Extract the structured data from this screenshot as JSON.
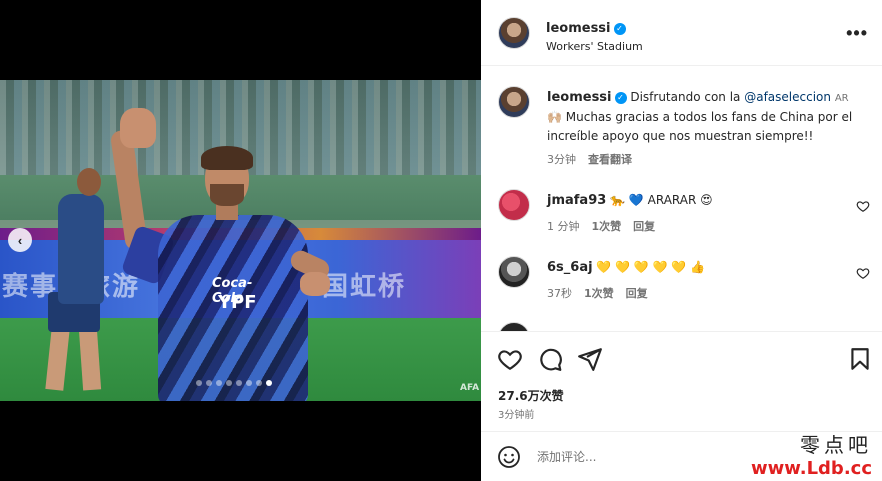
{
  "post": {
    "username": "leomessi",
    "location": "Workers' Stadium",
    "more_label": "•••",
    "prev_label": "‹",
    "image": {
      "banner_left": "赛事",
      "banner_mid": "旅游",
      "banner_right": "国虹桥",
      "sponsor": "Coca-Cola",
      "sponsor2": "YPF",
      "afa_mark": "AFA",
      "slide_count": 8,
      "active_slide": 8
    }
  },
  "caption": {
    "username": "leomessi",
    "text_pre": "Disfrutando con la ",
    "mention": "@afaseleccion",
    "tag": "AR",
    "text_post": "🙌🏼 Muchas gracias a todos los fans de China por el increíble apoyo que nos muestran siempre!!",
    "time": "3分钟",
    "translate": "查看翻译"
  },
  "comments": [
    {
      "username": "jmafa93",
      "text": "🐆 💙 ARARAR 😍",
      "time": "1 分钟",
      "likes": "1次赞",
      "reply": "回复"
    },
    {
      "username": "6s_6aj",
      "text": "💛 💛 💛 💛 💛 👍",
      "time": "37秒",
      "likes": "1次赞",
      "reply": "回复"
    }
  ],
  "stats": {
    "likes": "27.6万次赞",
    "time_ago": "3分钟前"
  },
  "add_comment": {
    "placeholder": "添加评论..."
  },
  "watermark": {
    "top": "零点吧",
    "bottom": "www.Ldb.cc"
  },
  "colors": {
    "verified": "#0095f6",
    "mention": "#00376b",
    "muted": "#737373",
    "watermark_red": "#e02020"
  }
}
